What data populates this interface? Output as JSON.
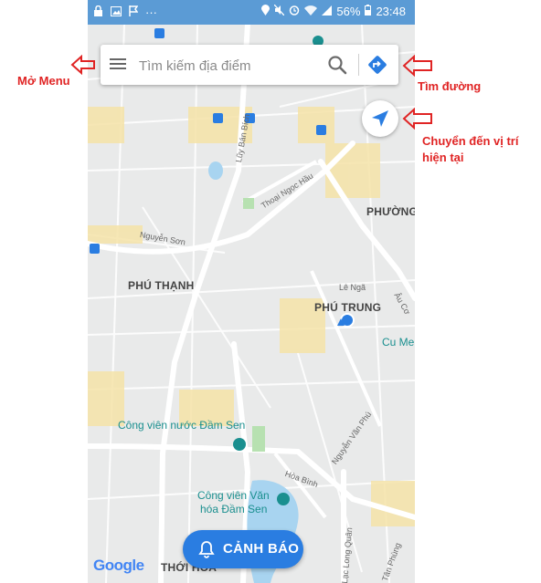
{
  "status_bar": {
    "battery": "56%",
    "time": "23:48",
    "dots": "···"
  },
  "search": {
    "placeholder": "Tìm kiếm địa điểm"
  },
  "map_labels": {
    "phu_thanh": "PHÚ THẠNH",
    "phu_trung": "PHÚ TRUNG",
    "phuong": "PHƯỜNG",
    "thoi_hoa": "THỚI HOÀ",
    "luy_ban_bich": "Lũy Bán Bích",
    "thoai_ngoc_hau": "Thoại Ngọc Hầu",
    "nguyen_son": "Nguyễn Sơn",
    "le_nga": "Lê Ngã",
    "au_co": "Âu Cơ",
    "cu_me": "Cu Me",
    "nguyen_van_phu": "Nguyễn Văn Phú",
    "hoa_binh": "Hòa Bình",
    "lac_long_quan": "Lạc Long Quân",
    "tan_phung": "Tân Phùng",
    "park_line1": "Công viên nước Đầm Sen",
    "park2_line1": "Công viên Văn",
    "park2_line2": "hóa Đầm Sen"
  },
  "alert_button": {
    "label": "CẢNH BÁO"
  },
  "branding": {
    "google": "Google"
  },
  "annotations": {
    "menu": "Mở Menu",
    "directions": "Tìm đường",
    "locate_line1": "Chuyển đến vị trí",
    "locate_line2": "hiện tại"
  },
  "colors": {
    "status_bar": "#5b9bd5",
    "accent_blue": "#2a7de1",
    "annotation_red": "#e02424",
    "road_yellow": "#f5e3a8"
  },
  "icons": {
    "menu": "hamburger-icon",
    "search": "search-icon",
    "directions": "directions-icon",
    "locate": "navigation-arrow-icon",
    "alert": "bell-icon"
  }
}
